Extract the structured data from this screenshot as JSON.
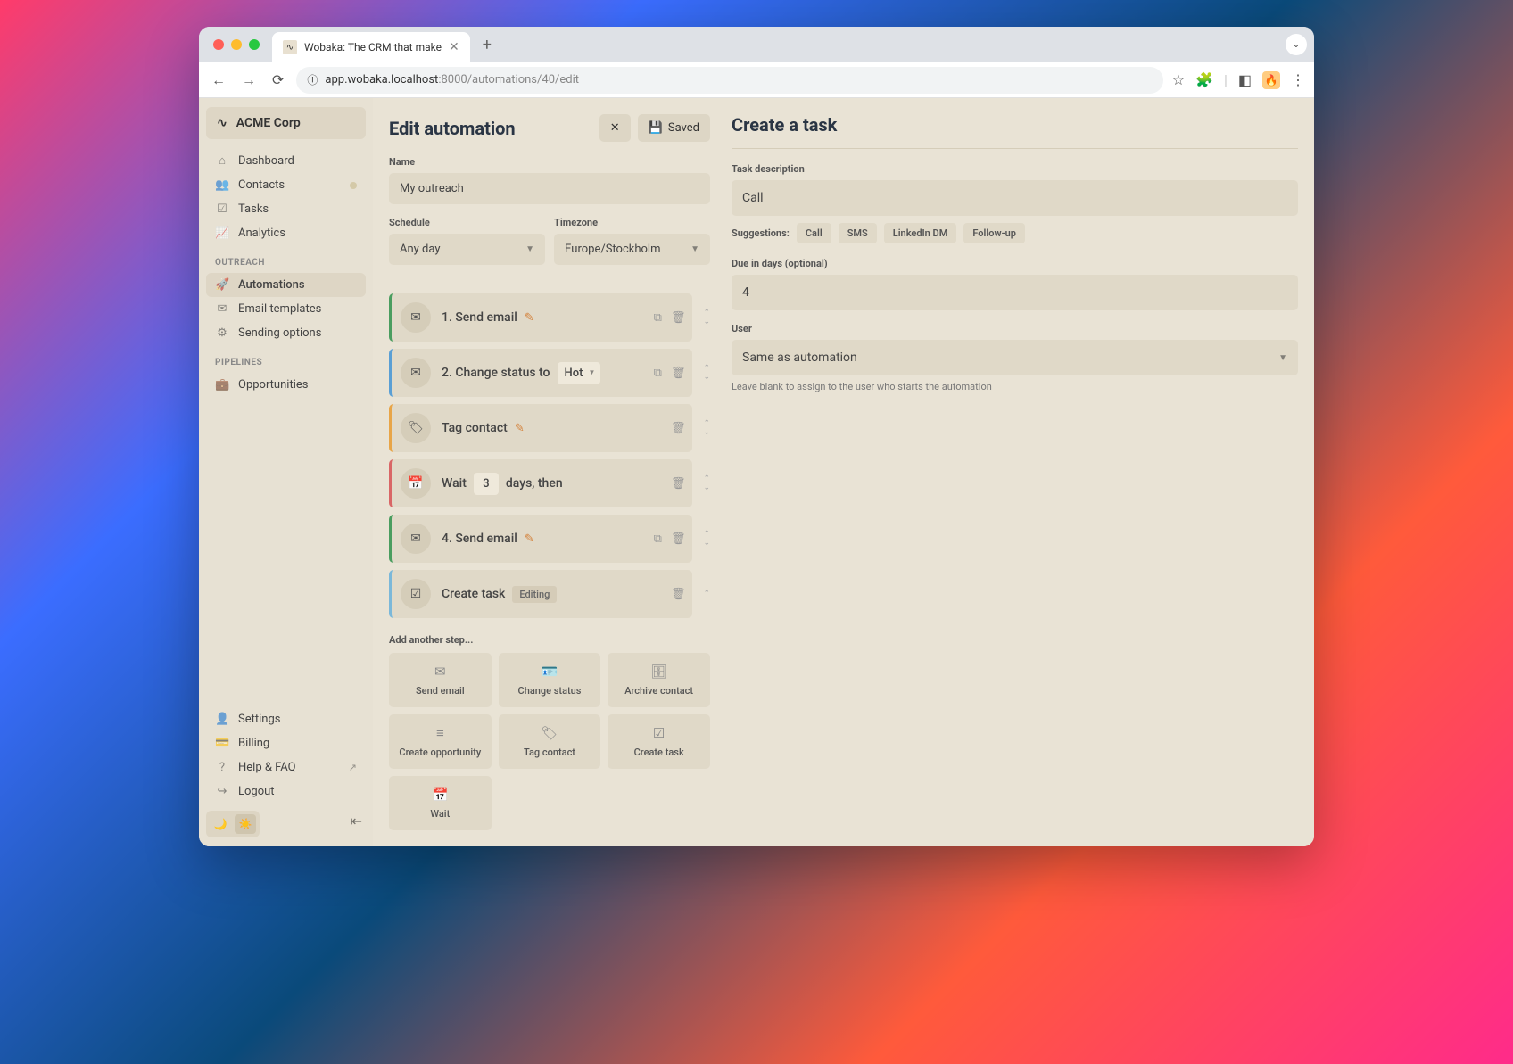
{
  "browser": {
    "tab_title": "Wobaka: The CRM that make",
    "url_host": "app.wobaka.localhost",
    "url_port": ":8000",
    "url_path": "/automations/40/edit"
  },
  "sidebar": {
    "org_name": "ACME Corp",
    "org_logo": "∿",
    "items_main": [
      {
        "icon": "⌂",
        "label": "Dashboard"
      },
      {
        "icon": "👥",
        "label": "Contacts",
        "badge": true
      },
      {
        "icon": "☑",
        "label": "Tasks"
      },
      {
        "icon": "📈",
        "label": "Analytics"
      }
    ],
    "section_outreach": "OUTREACH",
    "items_outreach": [
      {
        "icon": "🚀",
        "label": "Automations",
        "active": true
      },
      {
        "icon": "✉",
        "label": "Email templates"
      },
      {
        "icon": "⚙",
        "label": "Sending options"
      }
    ],
    "section_pipelines": "PIPELINES",
    "items_pipelines": [
      {
        "icon": "💼",
        "label": "Opportunities"
      }
    ],
    "items_bottom": [
      {
        "icon": "👤",
        "label": "Settings"
      },
      {
        "icon": "💳",
        "label": "Billing"
      },
      {
        "icon": "?",
        "label": "Help & FAQ",
        "ext": true
      },
      {
        "icon": "↪",
        "label": "Logout"
      }
    ]
  },
  "edit": {
    "title": "Edit automation",
    "close": "✕",
    "save_icon": "💾",
    "save_label": "Saved",
    "name_label": "Name",
    "name_value": "My outreach",
    "schedule_label": "Schedule",
    "schedule_value": "Any day",
    "timezone_label": "Timezone",
    "timezone_value": "Europe/Stockholm",
    "steps": [
      {
        "color": "green",
        "icon": "✉",
        "label": "1. Send email",
        "editable": true,
        "dup": true,
        "del": true,
        "updown": true
      },
      {
        "color": "blue",
        "icon": "✉",
        "label": "2. Change status to",
        "select": "Hot",
        "dup": true,
        "del": true,
        "updown": true
      },
      {
        "color": "orange",
        "icon": "🏷",
        "label": "Tag contact",
        "editable": true,
        "del": true,
        "updown": true
      },
      {
        "color": "red",
        "icon": "📅",
        "label_pre": "Wait",
        "mini_input": "3",
        "label_post": "days, then",
        "del": true,
        "updown": true
      },
      {
        "color": "green",
        "icon": "✉",
        "label": "4. Send email",
        "editable": true,
        "dup": true,
        "del": true,
        "updown": true
      },
      {
        "color": "lightblue",
        "icon": "☑",
        "label": "Create task",
        "editing": "Editing",
        "del": true,
        "up_only": true
      }
    ],
    "add_label": "Add another step...",
    "add_tiles": [
      {
        "icon": "✉",
        "label": "Send email"
      },
      {
        "icon": "🪪",
        "label": "Change status"
      },
      {
        "icon": "🗄",
        "label": "Archive contact"
      },
      {
        "icon": "≡",
        "label": "Create opportunity"
      },
      {
        "icon": "🏷",
        "label": "Tag contact"
      },
      {
        "icon": "☑",
        "label": "Create task"
      },
      {
        "icon": "📅",
        "label": "Wait"
      }
    ]
  },
  "panel": {
    "title": "Create a task",
    "desc_label": "Task description",
    "desc_value": "Call",
    "suggestions_label": "Suggestions:",
    "suggestions": [
      "Call",
      "SMS",
      "LinkedIn DM",
      "Follow-up"
    ],
    "due_label": "Due in days (optional)",
    "due_value": "4",
    "user_label": "User",
    "user_value": "Same as automation",
    "hint": "Leave blank to assign to the user who starts the automation"
  }
}
